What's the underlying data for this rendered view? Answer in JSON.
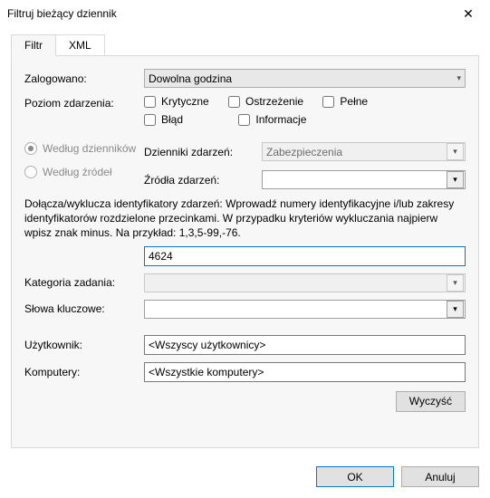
{
  "window": {
    "title": "Filtruj bieżący dziennik"
  },
  "tabs": {
    "filter": "Filtr",
    "xml": "XML"
  },
  "labels": {
    "logged": "Zalogowano:",
    "event_level": "Poziom zdarzenia:",
    "by_logs": "Według dzienników",
    "by_sources": "Według źródeł",
    "event_logs": "Dzienniki zdarzeń:",
    "event_sources": "Źródła zdarzeń:",
    "task_category": "Kategoria zadania:",
    "keywords": "Słowa kluczowe:",
    "user": "Użytkownik:",
    "computers": "Komputery:"
  },
  "values": {
    "logged_time": "Dowolna godzina",
    "event_logs_value": "Zabezpieczenia",
    "event_sources_value": "",
    "event_ids": "4624",
    "task_category": "",
    "keywords": "",
    "user": "<Wszyscy użytkownicy>",
    "computers": "<Wszystkie komputery>"
  },
  "levels": {
    "critical": "Krytyczne",
    "warning": "Ostrzeżenie",
    "verbose": "Pełne",
    "error": "Błąd",
    "information": "Informacje"
  },
  "desc": "Dołącza/wyklucza identyfikatory zdarzeń: Wprowadź numery identyfikacyjne i/lub zakresy identyfikatorów rozdzielone przecinkami. W przypadku kryteriów wykluczania najpierw wpisz znak minus. Na przykład: 1,3,5-99,-76.",
  "buttons": {
    "clear": "Wyczyść",
    "ok": "OK",
    "cancel": "Anuluj"
  }
}
